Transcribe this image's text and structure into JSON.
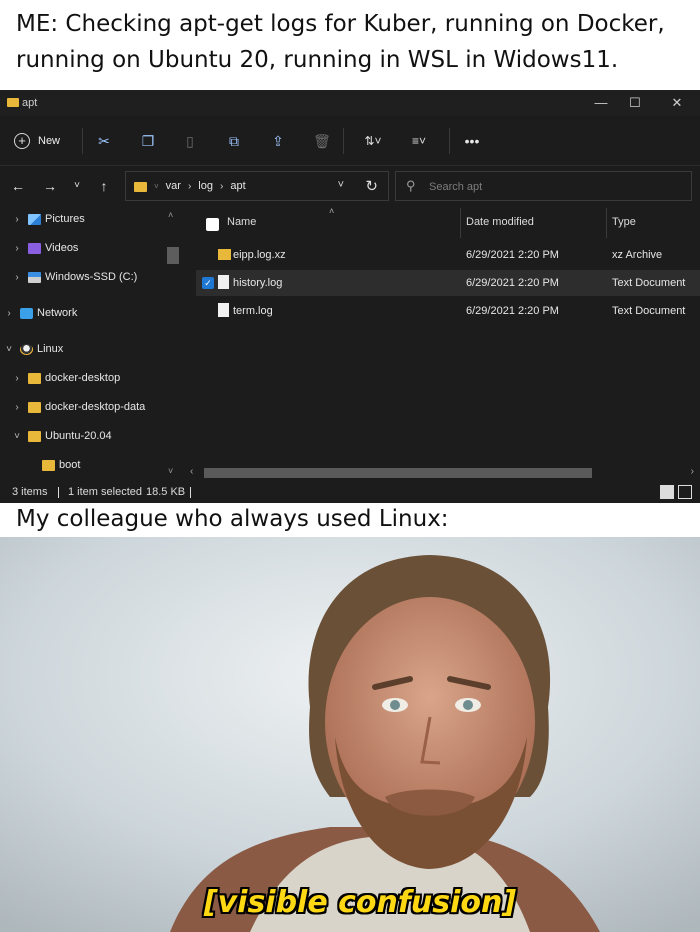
{
  "meme": {
    "top_caption": "ME: Checking apt-get logs for Kuber, running on Docker, running on Ubuntu 20, running in WSL in Widows11.",
    "middle_caption": "My colleague who always used Linux:",
    "subtitle": "[visible confusion]"
  },
  "window": {
    "title": "apt",
    "controls": [
      "minimize",
      "maximize",
      "close"
    ]
  },
  "toolbar": {
    "new_label": "New",
    "icons": [
      "cut-icon",
      "copy-icon",
      "paste-icon",
      "rename-icon",
      "share-icon",
      "delete-icon",
      "sort-icon",
      "view-icon",
      "more-icon"
    ]
  },
  "address": {
    "crumbs": [
      "var",
      "log",
      "apt"
    ]
  },
  "search": {
    "placeholder": "Search apt"
  },
  "sidebar": {
    "items": [
      {
        "label": "Pictures",
        "icon": "pictures-icon"
      },
      {
        "label": "Videos",
        "icon": "videos-icon"
      },
      {
        "label": "Windows-SSD (C:)",
        "icon": "drive-icon"
      },
      {
        "label": "Network",
        "icon": "network-icon"
      },
      {
        "label": "Linux",
        "icon": "linux-icon"
      },
      {
        "label": "docker-desktop",
        "icon": "folder-icon"
      },
      {
        "label": "docker-desktop-data",
        "icon": "folder-icon"
      },
      {
        "label": "Ubuntu-20.04",
        "icon": "folder-icon"
      },
      {
        "label": "boot",
        "icon": "folder-icon"
      }
    ]
  },
  "columns": {
    "name": "Name",
    "date": "Date modified",
    "type": "Type"
  },
  "files": [
    {
      "name": "eipp.log.xz",
      "date": "6/29/2021 2:20 PM",
      "type": "xz Archive",
      "selected": false
    },
    {
      "name": "history.log",
      "date": "6/29/2021 2:20 PM",
      "type": "Text Document",
      "selected": true
    },
    {
      "name": "term.log",
      "date": "6/29/2021 2:20 PM",
      "type": "Text Document",
      "selected": false
    }
  ],
  "status": {
    "items": "3 items",
    "selected": "1 item selected",
    "size": "18.5 KB"
  },
  "colors": {
    "window_bg": "#1c1c1c",
    "folder": "#e8b83a",
    "accent": "#1e78d4",
    "subtitle": "#ffd814"
  }
}
